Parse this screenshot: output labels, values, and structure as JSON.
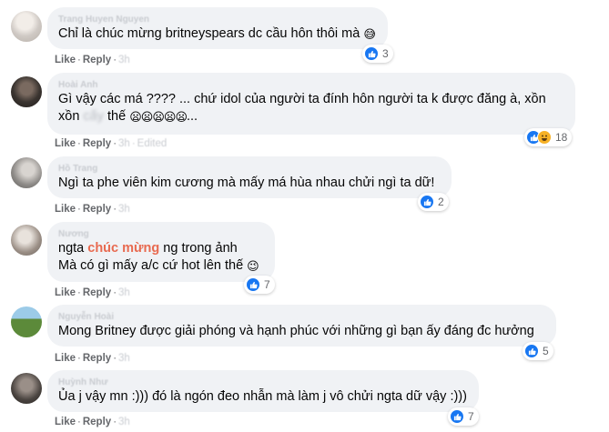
{
  "actions": {
    "like": "Like",
    "reply": "Reply",
    "dot": "·"
  },
  "comments": [
    {
      "author": "Trang Huyen Nguyen",
      "text_a": "Chỉ là chúc mừng britneyspears dc cầu hôn thôi mà",
      "emoji": "😅",
      "time": "3h",
      "edited": "",
      "reactions": {
        "types": [
          "like"
        ],
        "count": "3"
      },
      "avatar_color": "#cfc9c4"
    },
    {
      "author": "Hoài Anh",
      "line1": "Gì vậy các má ???? ... chứ idol của người ta đính hôn người ta k được đăng à, xồn",
      "line2_a": "xồn",
      "line2_blur": "cấy",
      "line2_b": "thế",
      "emoji": "😦😦😦😦😦",
      "line2_tail": "...",
      "time": "3h",
      "edited": "Edited",
      "reactions": {
        "types": [
          "like",
          "haha"
        ],
        "count": "18"
      },
      "avatar_color": "#3a3430"
    },
    {
      "author": "Hồ Trang",
      "text_a": "Ngì ta phe viên kim cương mà mấy má hùa nhau chửi ngì ta dữ!",
      "time": "3h",
      "edited": "",
      "reactions": {
        "types": [
          "like"
        ],
        "count": "2"
      },
      "avatar_color": "#8d8a87"
    },
    {
      "author": "Nương",
      "line1_a": "ngta",
      "line1_hl": "chúc mừng",
      "line1_b": "ng trong ảnh",
      "line2": "Mà có gì mấy a/c cứ hot lên thế",
      "emoji": "😉",
      "time": "3h",
      "edited": "",
      "reactions": {
        "types": [
          "like"
        ],
        "count": "7"
      },
      "avatar_color": "#9b8f86"
    },
    {
      "author": "Nguyễn Hoài",
      "text_a": "Mong Britney được giải phóng và hạnh phúc với những gì bạn ấy đáng đc hưởng",
      "time": "3h",
      "edited": "",
      "reactions": {
        "types": [
          "like"
        ],
        "count": "5"
      },
      "avatar_color": "#5c8a3a"
    },
    {
      "author": "Huỳnh Như",
      "text_a": "Ủa j vậy mn :))) đó là ngón đeo nhẫn mà làm j vô chửi ngta dữ vậy :)))",
      "time": "3h",
      "edited": "",
      "reactions": {
        "types": [
          "like"
        ],
        "count": "7"
      },
      "avatar_color": "#4a4440"
    }
  ]
}
